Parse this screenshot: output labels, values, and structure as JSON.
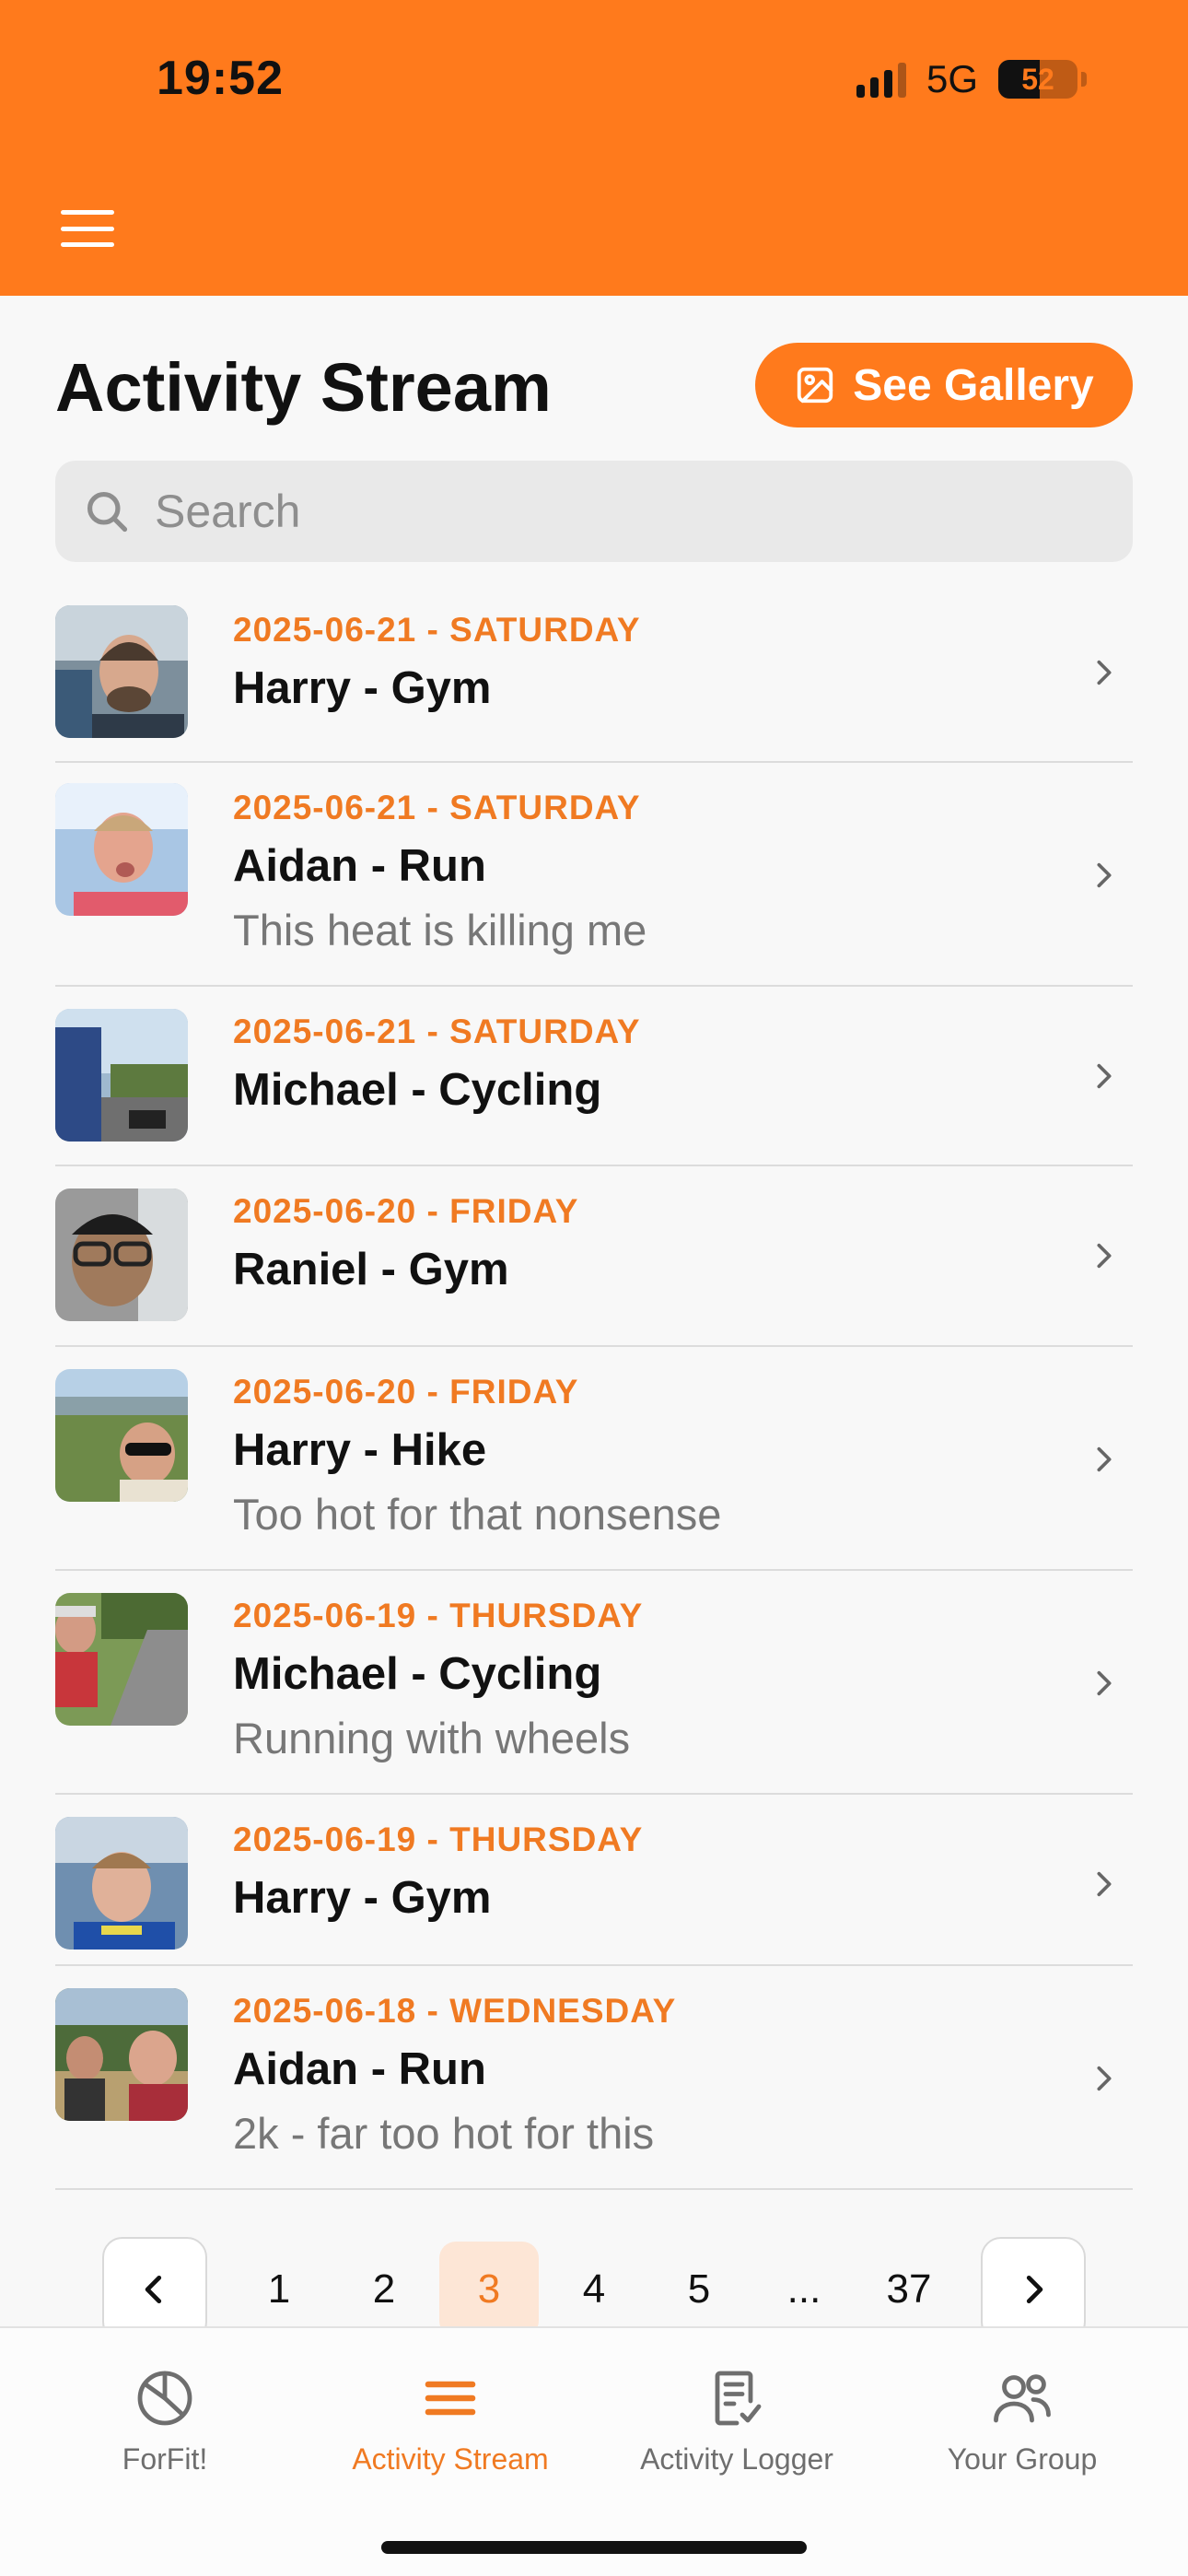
{
  "status_bar": {
    "time": "19:52",
    "network": "5G",
    "battery": "52"
  },
  "header": {
    "menu_icon": "hamburger-icon"
  },
  "page": {
    "title": "Activity Stream",
    "gallery_button": "See Gallery",
    "search_placeholder": "Search"
  },
  "activities": [
    {
      "date": "2025-06-21 - SATURDAY",
      "title": "Harry - Gym",
      "note": ""
    },
    {
      "date": "2025-06-21 - SATURDAY",
      "title": "Aidan - Run",
      "note": "This heat is killing me"
    },
    {
      "date": "2025-06-21 - SATURDAY",
      "title": "Michael - Cycling",
      "note": ""
    },
    {
      "date": "2025-06-20 - FRIDAY",
      "title": "Raniel - Gym",
      "note": ""
    },
    {
      "date": "2025-06-20 - FRIDAY",
      "title": "Harry - Hike",
      "note": "Too hot for that nonsense"
    },
    {
      "date": "2025-06-19 - THURSDAY",
      "title": "Michael - Cycling",
      "note": "Running with wheels"
    },
    {
      "date": "2025-06-19 - THURSDAY",
      "title": "Harry - Gym",
      "note": ""
    },
    {
      "date": "2025-06-18 - WEDNESDAY",
      "title": "Aidan - Run",
      "note": "2k - far too hot for this"
    }
  ],
  "pagination": {
    "pages": [
      "1",
      "2",
      "3",
      "4",
      "5",
      "...",
      "37"
    ],
    "current": "3"
  },
  "tabs": [
    {
      "label": "ForFit!",
      "icon": "pie-chart-icon",
      "active": false
    },
    {
      "label": "Activity Stream",
      "icon": "list-icon",
      "active": true
    },
    {
      "label": "Activity Logger",
      "icon": "checklist-icon",
      "active": false
    },
    {
      "label": "Your Group",
      "icon": "group-icon",
      "active": false
    }
  ],
  "colors": {
    "accent": "#ff7a1c",
    "date_text": "#f07a22",
    "background": "#f8f8f8"
  }
}
